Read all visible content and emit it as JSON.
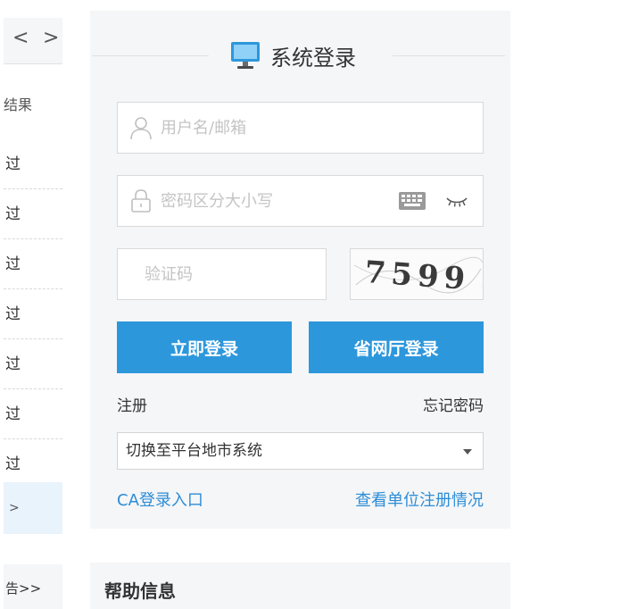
{
  "left_panel": {
    "prev_arrow": "<",
    "next_arrow": ">",
    "header": "结果",
    "items": [
      "过",
      "过",
      "过",
      "过",
      "过",
      "过",
      "过"
    ],
    "more": ">",
    "notice": "告>>"
  },
  "login": {
    "title": "系统登录",
    "username_placeholder": "用户名/邮箱",
    "password_placeholder": "密码区分大小写",
    "captcha_placeholder": "验证码",
    "captcha_text": "7599",
    "login_button": "立即登录",
    "province_login_button": "省网厅登录",
    "register_link": "注册",
    "forgot_link": "忘记密码",
    "platform_select": "切换至平台地市系统",
    "ca_link": "CA登录入口",
    "unit_link": "查看单位注册情况"
  },
  "help": {
    "title": "帮助信息"
  },
  "colors": {
    "primary": "#2d97dc",
    "link": "#2d8dd6",
    "panel_bg": "#f5f6f8"
  },
  "icons": {
    "title": "monitor-icon",
    "username": "user-icon",
    "password": "lock-icon",
    "keyboard": "keyboard-icon",
    "visibility": "eye-closed-icon",
    "select": "chevron-down-icon"
  }
}
